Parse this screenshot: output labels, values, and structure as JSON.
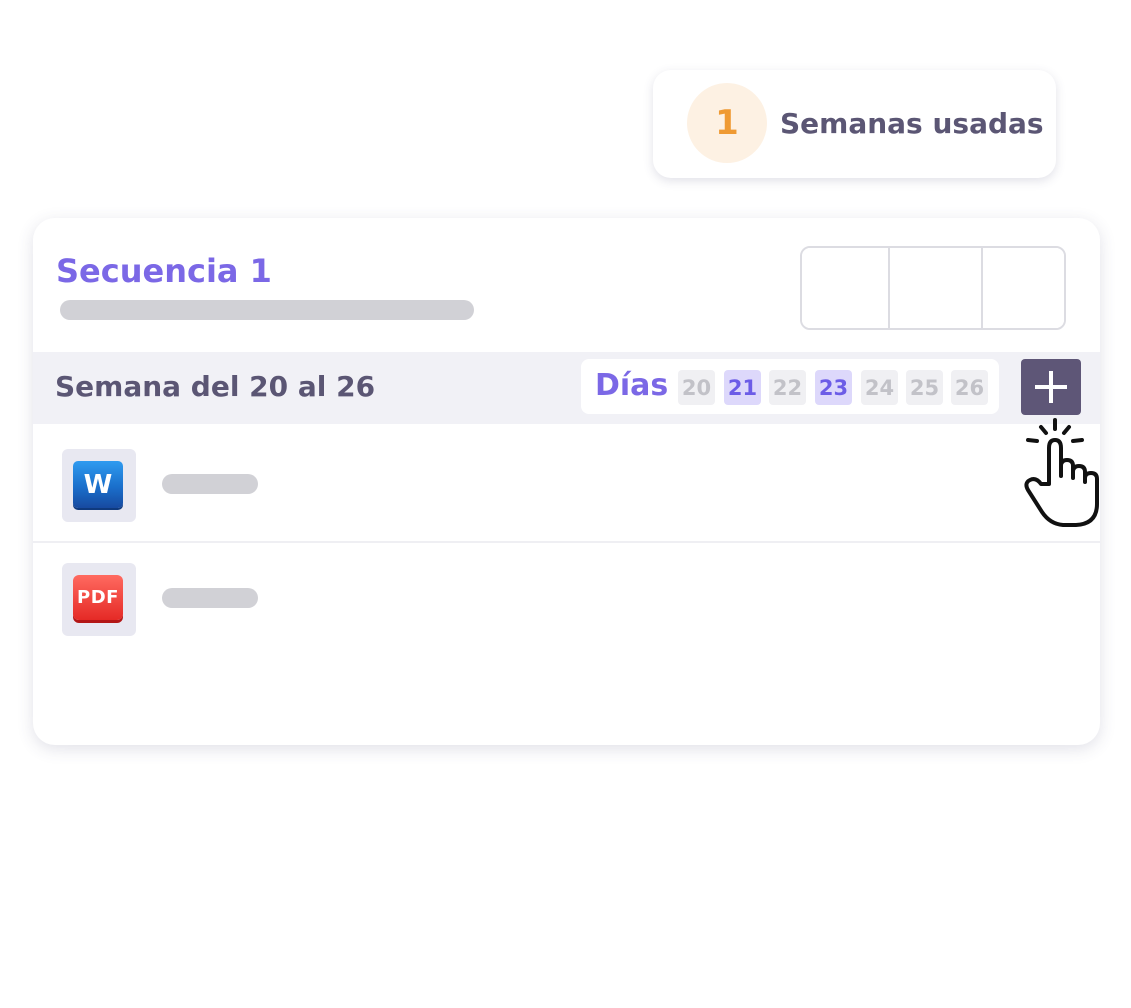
{
  "weeks_used": {
    "count": "1",
    "label": "Semanas usadas"
  },
  "sequence": {
    "title": "Secuencia 1"
  },
  "week": {
    "label": "Semana del 20 al 26",
    "days_label": "Días",
    "days": [
      {
        "num": "20",
        "active": false
      },
      {
        "num": "21",
        "active": true
      },
      {
        "num": "22",
        "active": false
      },
      {
        "num": "23",
        "active": true
      },
      {
        "num": "24",
        "active": false
      },
      {
        "num": "25",
        "active": false
      },
      {
        "num": "26",
        "active": false
      }
    ],
    "add_icon": "plus-icon"
  },
  "files": [
    {
      "type": "word",
      "icon": "word-icon",
      "badge": "W"
    },
    {
      "type": "pdf",
      "icon": "pdf-icon",
      "badge": "PDF"
    }
  ],
  "colors": {
    "accent": "#7b68e6",
    "badge_orange": "#ef9a33",
    "dark_button": "#5e5677",
    "active_day_bg": "#ddd8fb"
  }
}
